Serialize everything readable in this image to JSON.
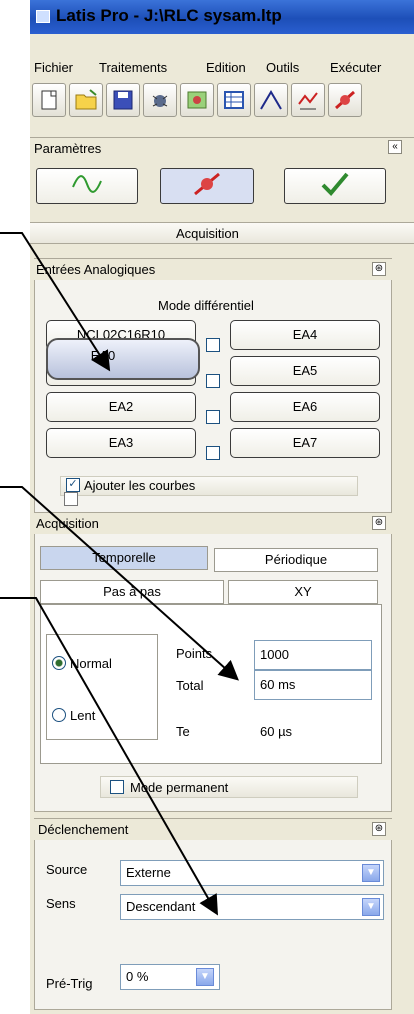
{
  "window": {
    "title": "Latis Pro - J:\\RLC sysam.ltp"
  },
  "menu": {
    "items": [
      "Fichier",
      "Traitements",
      "Edition",
      "Outils",
      "Exécuter"
    ]
  },
  "toolbar": {
    "icons": [
      "new-file-icon",
      "open-folder-icon",
      "save-icon",
      "bug-icon",
      "image-icon",
      "table-icon",
      "curve-icon",
      "chart-icon",
      "acquisition-icon"
    ]
  },
  "parametres": {
    "title": "Paramètres",
    "collapse": "«",
    "tab_label": "Acquisition"
  },
  "entrees": {
    "title": "Entrées Analogiques",
    "mode_label": "Mode différentiel",
    "left_buttons": [
      "NCL02C16R10",
      "",
      "EA2",
      "EA3"
    ],
    "right_buttons": [
      "EA4",
      "EA5",
      "EA6",
      "EA7"
    ],
    "dragged_button": "EA0",
    "ajouter_label": "Ajouter les courbes"
  },
  "acquisition": {
    "title": "Acquisition",
    "tabs_row1": [
      "Temporelle",
      "Périodique"
    ],
    "tabs_row2": [
      "Pas à pas",
      "XY"
    ],
    "radio_normal": "Normal",
    "radio_lent": "Lent",
    "points_label": "Points",
    "points_value": "1000",
    "total_label": "Total",
    "total_value": "60 ms",
    "te_label": "Te",
    "te_value": "60 µs",
    "mode_permanent": "Mode permanent"
  },
  "declenchement": {
    "title": "Déclenchement",
    "source_label": "Source",
    "source_value": "Externe",
    "sens_label": "Sens",
    "sens_value": "Descendant",
    "pretrig_label": "Pré-Trig",
    "pretrig_value": "0 %"
  }
}
